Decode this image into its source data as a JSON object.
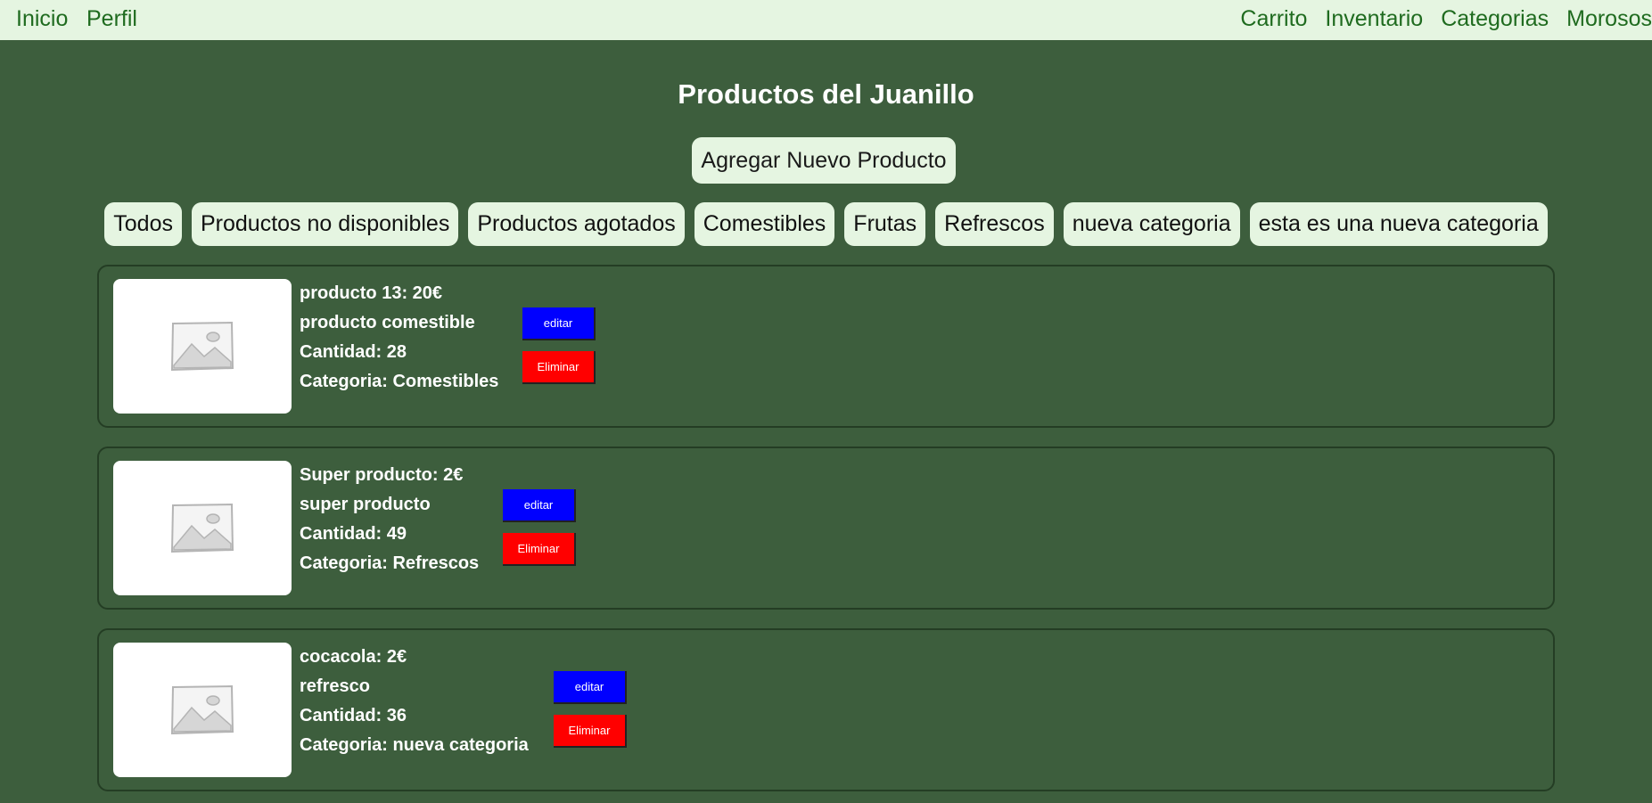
{
  "nav": {
    "left": [
      "Inicio",
      "Perfil"
    ],
    "right": [
      "Carrito",
      "Inventario",
      "Categorias",
      "Morosos"
    ]
  },
  "page": {
    "title": "Productos del Juanillo",
    "add_button": "Agregar Nuevo Producto"
  },
  "filters": [
    "Todos",
    "Productos no disponibles",
    "Productos agotados",
    "Comestibles",
    "Frutas",
    "Refrescos",
    "nueva categoria",
    "esta es una nueva categoria"
  ],
  "products": [
    {
      "title": "producto 13: 20€",
      "description": "producto comestible",
      "quantity": "Cantidad: 28",
      "category": "Categoria: Comestibles",
      "edit": "editar",
      "delete": "Eliminar"
    },
    {
      "title": "Super producto: 2€",
      "description": "super producto",
      "quantity": "Cantidad: 49",
      "category": "Categoria: Refrescos",
      "edit": "editar",
      "delete": "Eliminar"
    },
    {
      "title": "cocacola: 2€",
      "description": "refresco",
      "quantity": "Cantidad: 36",
      "category": "Categoria: nueva categoria",
      "edit": "editar",
      "delete": "Eliminar"
    }
  ],
  "colors": {
    "background": "#3d5e3d",
    "nav_bg": "#e5f5e1",
    "nav_link": "#1f6b1f",
    "edit_button": "#0000ff",
    "delete_button": "#ff0000"
  },
  "icons": {
    "product_image": "image-placeholder-icon"
  }
}
